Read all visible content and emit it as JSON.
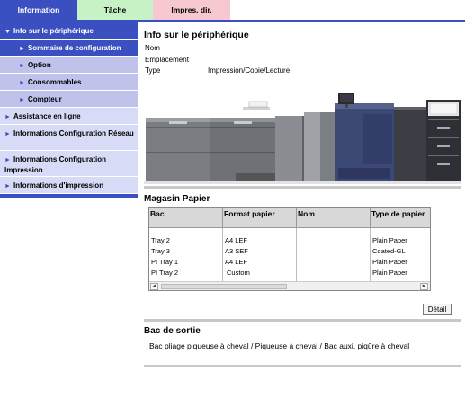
{
  "tabs": [
    {
      "label": "Information"
    },
    {
      "label": "Tâche"
    },
    {
      "label": "Impres. dir."
    }
  ],
  "sidebar": {
    "items": [
      {
        "label": "Info sur le périphérique"
      },
      {
        "label": "Sommaire de configuration"
      },
      {
        "label": "Option"
      },
      {
        "label": "Consommables"
      },
      {
        "label": "Compteur"
      },
      {
        "label": "Assistance en ligne"
      },
      {
        "label": "Informations Configuration Réseau"
      },
      {
        "label": "Informations Configuration Impression"
      },
      {
        "label": "Informations d'impression"
      }
    ]
  },
  "device": {
    "title": "Info sur le périphérique",
    "fields": [
      {
        "key": "Nom",
        "value": ""
      },
      {
        "key": "Emplacement",
        "value": ""
      },
      {
        "key": "Type",
        "value": "Impression/Copie/Lecture"
      }
    ]
  },
  "paper": {
    "title": "Magasin Papier",
    "columns": [
      "Bac",
      "Format papier",
      "Nom",
      "Type de papier"
    ],
    "rows": [
      [
        "Tray 2",
        "A4 LEF",
        "",
        "Plain Paper"
      ],
      [
        "Tray 3",
        "A3 SEF",
        "",
        "Coated-GL"
      ],
      [
        "PI Tray 1",
        "A4 LEF",
        "",
        "Plain Paper"
      ],
      [
        "PI Tray 2",
        "Custom",
        "",
        "Plain Paper"
      ]
    ],
    "detail_label": "Détail"
  },
  "output": {
    "title": "Bac de sortie",
    "text": "Bac pliage piqueuse à cheval / Piqueuse à cheval / Bac auxi. piqûre à cheval"
  }
}
